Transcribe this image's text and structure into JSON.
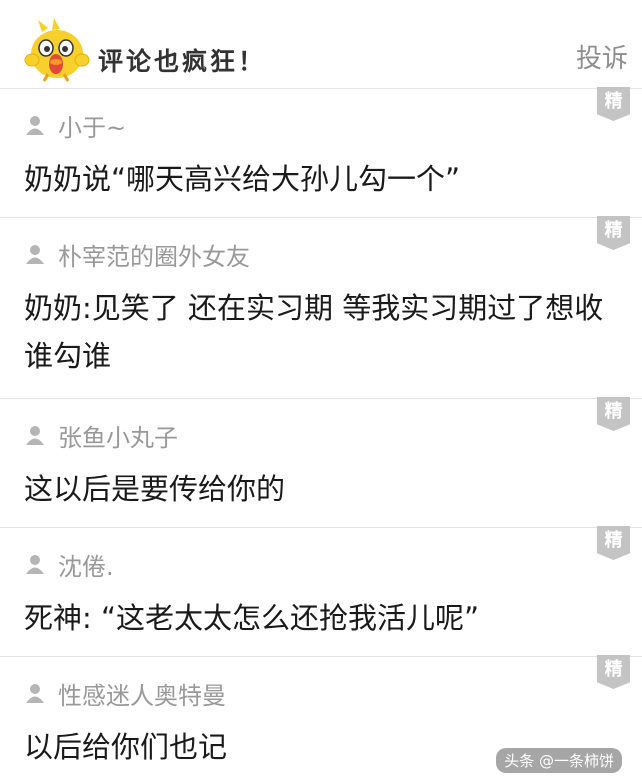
{
  "header": {
    "title": "评论也疯狂！",
    "report_label": "投诉"
  },
  "comments": [
    {
      "badge": "精",
      "username": "小于~",
      "text": "奶奶说“哪天高兴给大孙儿勾一个”"
    },
    {
      "badge": "精",
      "username": "朴宰范的圈外女友",
      "text": "奶奶:见笑了 还在实习期 等我实习期过了想收谁勾谁"
    },
    {
      "badge": "精",
      "username": "张鱼小丸子",
      "text": "这以后是要传给你的"
    },
    {
      "badge": "精",
      "username": "沈倦.",
      "text": "死神: “这老太太怎么还抢我活儿呢”"
    },
    {
      "badge": "精",
      "username": "性感迷人奥特曼",
      "text": "以后给你们也记"
    }
  ],
  "watermark": "头条 @一条柿饼",
  "colors": {
    "badge": "#c4c4c4",
    "username": "#999999",
    "report": "#8e8e8e",
    "divider": "#e3e3e3"
  },
  "icons": {
    "mascot": "yellow-chick-mascot-icon",
    "user": "user-silhouette-icon"
  }
}
